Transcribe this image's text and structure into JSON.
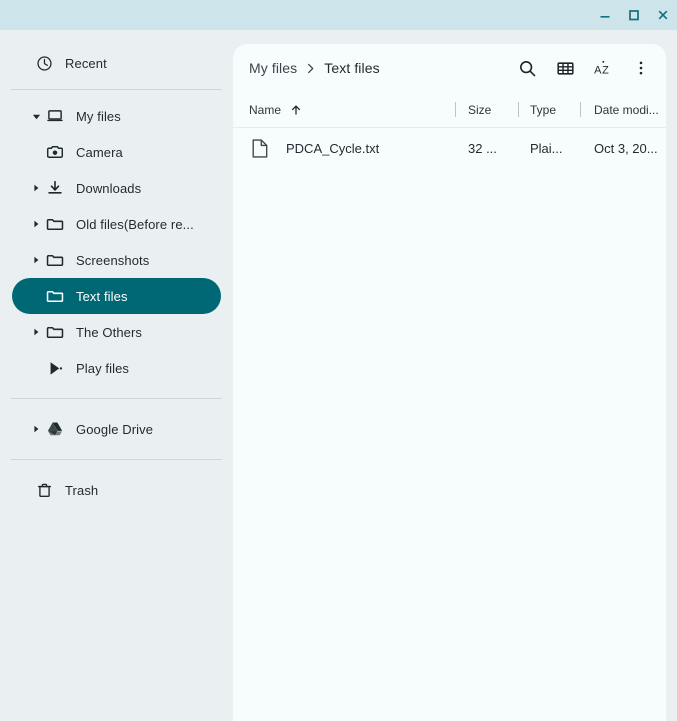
{
  "window": {
    "controls": [
      {
        "name": "minimize-button",
        "glyph": "minimize"
      },
      {
        "name": "maximize-button",
        "glyph": "maximize"
      },
      {
        "name": "close-button",
        "glyph": "close"
      }
    ],
    "titlebar_color": "#cde4ea"
  },
  "sidebar": {
    "background": "#eaf0f2",
    "selected_color": "#006874",
    "groups": [
      {
        "items": [
          {
            "label": "Recent",
            "icon": "clock-icon",
            "depth": 0,
            "expander": "none",
            "selected": false
          }
        ]
      },
      {
        "items": [
          {
            "label": "My files",
            "icon": "computer-icon",
            "depth": 0,
            "expander": "expanded",
            "selected": false
          },
          {
            "label": "Camera",
            "icon": "camera-icon",
            "depth": 1,
            "expander": "none",
            "selected": false
          },
          {
            "label": "Downloads",
            "icon": "download-icon",
            "depth": 1,
            "expander": "collapsed",
            "selected": false
          },
          {
            "label": "Old files(Before re...",
            "icon": "folder-icon",
            "depth": 1,
            "expander": "collapsed",
            "selected": false
          },
          {
            "label": "Screenshots",
            "icon": "folder-icon",
            "depth": 1,
            "expander": "collapsed",
            "selected": false
          },
          {
            "label": "Text files",
            "icon": "folder-icon",
            "depth": 1,
            "expander": "none",
            "selected": true
          },
          {
            "label": "The Others",
            "icon": "folder-icon",
            "depth": 1,
            "expander": "collapsed",
            "selected": false
          },
          {
            "label": "Play files",
            "icon": "play-store-icon",
            "depth": 1,
            "expander": "none",
            "selected": false
          }
        ]
      },
      {
        "items": [
          {
            "label": "Google Drive",
            "icon": "google-drive-icon",
            "depth": 0,
            "expander": "collapsed",
            "selected": false
          }
        ]
      },
      {
        "items": [
          {
            "label": "Trash",
            "icon": "trash-icon",
            "depth": 0,
            "expander": "none",
            "selected": false
          }
        ]
      }
    ]
  },
  "main": {
    "breadcrumb": {
      "parent": "My files",
      "separator": "chevron-right-icon",
      "current": "Text files"
    },
    "toolbar_buttons": [
      {
        "name": "search-button",
        "icon": "search-icon"
      },
      {
        "name": "view-toggle-button",
        "icon": "grid-view-icon"
      },
      {
        "name": "sort-button",
        "icon": "sort-az-icon"
      },
      {
        "name": "more-options-button",
        "icon": "more-vertical-icon"
      }
    ],
    "columns": [
      {
        "key": "name",
        "label": "Name",
        "sorted": "ascending",
        "sort_icon": "arrow-up-icon"
      },
      {
        "key": "size",
        "label": "Size",
        "sorted": "none"
      },
      {
        "key": "type",
        "label": "Type",
        "sorted": "none"
      },
      {
        "key": "date",
        "label": "Date modi...",
        "sorted": "none"
      }
    ],
    "rows": [
      {
        "icon": "text-file-icon",
        "name": "PDCA_Cycle.txt",
        "size": "32 ...",
        "type": "Plai...",
        "date": "Oct 3, 20..."
      }
    ]
  }
}
